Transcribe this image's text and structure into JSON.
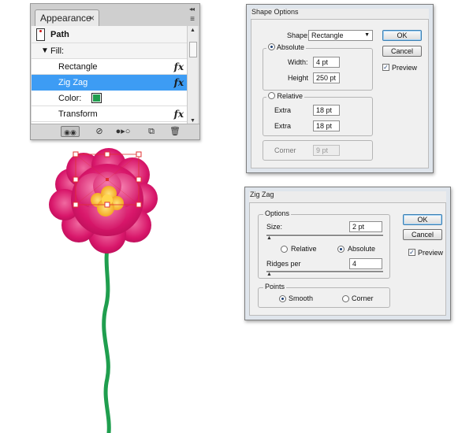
{
  "appearance_panel": {
    "tab_label": "Appearance",
    "close_glyph": "×",
    "collapse_glyph": "◂◂",
    "menu_glyph": "≡",
    "rows": {
      "path": "Path",
      "fill": "Fill:",
      "rectangle": "Rectangle",
      "zigzag": "Zig Zag",
      "color": "Color:",
      "transform": "Transform"
    },
    "fx_label": "fx",
    "fill_color": "#1f9e4e",
    "selected_row": "Zig Zag",
    "bottom_icons": [
      "visibility-toggle-icon",
      "clear-appearance-icon",
      "reduce-basic-icon",
      "duplicate-item-icon",
      "delete-icon"
    ]
  },
  "shape_options": {
    "title": "Shape Options",
    "shape_label": "Shape:",
    "shape_value": "Rectangle",
    "ok_label": "OK",
    "cancel_label": "Cancel",
    "preview_label": "Preview",
    "preview_checked": true,
    "absolute_label": "Absolute",
    "width_label": "Width:",
    "width_value": "4 pt",
    "height_label": "Height",
    "height_value": "250 pt",
    "relative_label": "Relative",
    "extra_label_1": "Extra",
    "extra_value_1": "18 pt",
    "extra_label_2": "Extra",
    "extra_value_2": "18 pt",
    "corner_label": "Corner",
    "corner_value": "9 pt",
    "size_mode": "Absolute"
  },
  "zigzag_dialog": {
    "title": "Zig Zag",
    "options_label": "Options",
    "size_label": "Size:",
    "size_value": "2 pt",
    "relative_label": "Relative",
    "absolute_label": "Absolute",
    "ridges_label": "Ridges per",
    "ridges_value": "4",
    "points_label": "Points",
    "smooth_label": "Smooth",
    "corner_label": "Corner",
    "ok_label": "OK",
    "cancel_label": "Cancel",
    "preview_label": "Preview",
    "preview_checked": true,
    "size_mode": "Absolute",
    "points_mode": "Smooth"
  },
  "artwork": {
    "petal_color": "#d8166a",
    "petal_light": "#f06aa0",
    "center_color": "#f5b322",
    "stem_color": "#1f9e4e",
    "selection_color": "#e03030"
  }
}
